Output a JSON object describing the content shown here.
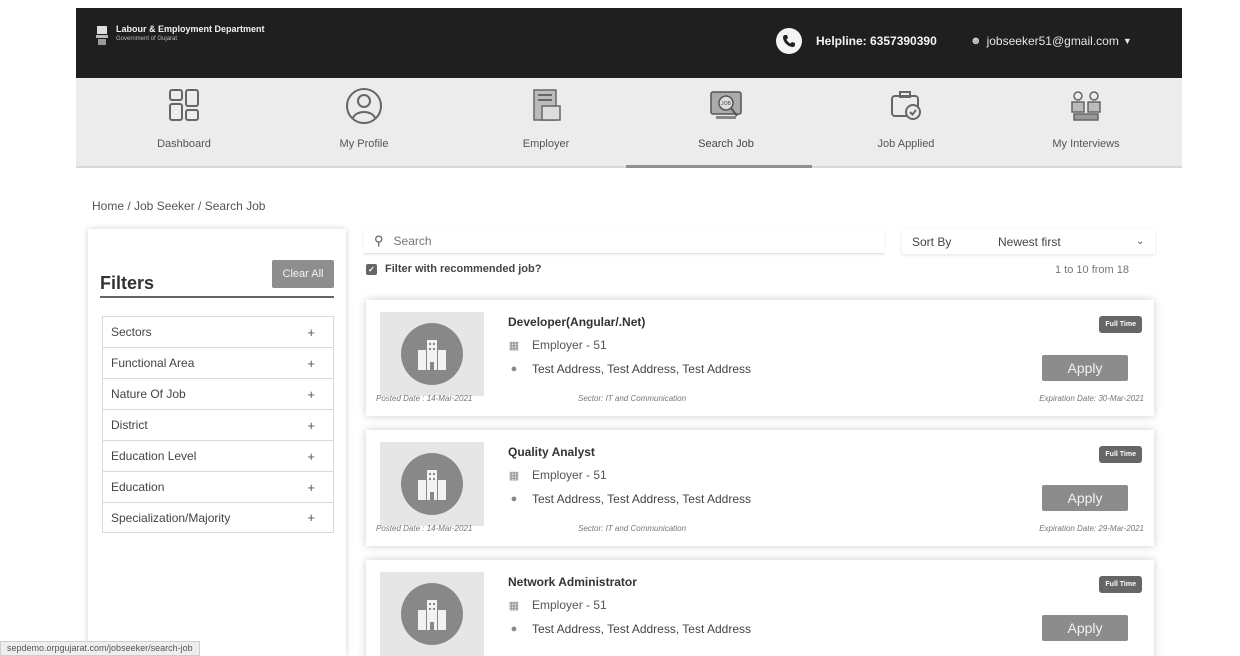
{
  "header": {
    "dept_title": "Labour & Employment Department",
    "dept_sub": "Government of Gujarat",
    "helpline": "Helpline: 6357390390",
    "user_email": "jobseeker51@gmail.com"
  },
  "nav": {
    "items": [
      {
        "label": "Dashboard",
        "icon": "dashboard-icon"
      },
      {
        "label": "My Profile",
        "icon": "profile-icon"
      },
      {
        "label": "Employer",
        "icon": "employer-icon"
      },
      {
        "label": "Search Job",
        "icon": "search-job-icon"
      },
      {
        "label": "Job Applied",
        "icon": "job-applied-icon"
      },
      {
        "label": "My Interviews",
        "icon": "interviews-icon"
      }
    ],
    "active": "Search Job"
  },
  "breadcrumb": "Home / Job Seeker / Search Job",
  "filters": {
    "title": "Filters",
    "clear_label": "Clear All",
    "items": [
      "Sectors",
      "Functional Area",
      "Nature Of Job",
      "District",
      "Education Level",
      "Education",
      "Specialization/Majority"
    ]
  },
  "search": {
    "placeholder": "Search",
    "sort_label": "Sort By",
    "sort_value": "Newest first",
    "recommended_label": "Filter with recommended job?",
    "result_count": "1 to 10 from 18"
  },
  "jobs": [
    {
      "title": "Developer(Angular/.Net)",
      "employer": "Employer - 51",
      "address": "Test Address, Test Address, Test Address",
      "posted": "Posted Date : 14-Mar-2021",
      "sector": "Sector: IT and Communication",
      "expiry": "Expiration Date: 30-Mar-2021",
      "badge": "Full Time",
      "apply": "Apply"
    },
    {
      "title": "Quality Analyst",
      "employer": "Employer - 51",
      "address": "Test Address, Test Address, Test Address",
      "posted": "Posted Date : 14-Mar-2021",
      "sector": "Sector: IT and Communication",
      "expiry": "Expiration Date: 29-Mar-2021",
      "badge": "Full Time",
      "apply": "Apply"
    },
    {
      "title": "Network Administrator",
      "employer": "Employer - 51",
      "address": "Test Address, Test Address, Test Address",
      "badge": "Full Time",
      "apply": "Apply"
    }
  ],
  "status_bar": "sepdemo.orpgujarat.com/jobseeker/search-job",
  "colors": {
    "header_bg": "#1f1f1f",
    "nav_bg": "#ececec",
    "button_gray": "#8c8c8c",
    "badge_bg": "#666666"
  }
}
